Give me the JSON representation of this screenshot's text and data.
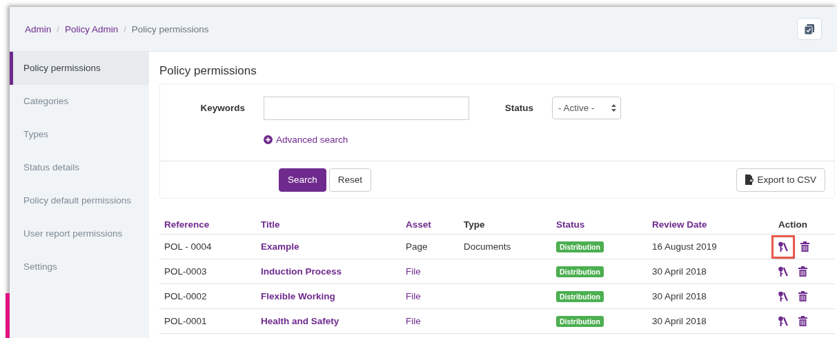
{
  "breadcrumb_separator": "/",
  "breadcrumb": [
    {
      "label": "Admin",
      "link": true
    },
    {
      "label": "Policy Admin",
      "link": true
    },
    {
      "label": "Policy permissions",
      "link": false
    }
  ],
  "sidebar": {
    "items": [
      {
        "label": "Policy permissions",
        "selected": true
      },
      {
        "label": "Categories",
        "selected": false
      },
      {
        "label": "Types",
        "selected": false
      },
      {
        "label": "Status details",
        "selected": false
      },
      {
        "label": "Policy default permissions",
        "selected": false
      },
      {
        "label": "User report permissions",
        "selected": false
      },
      {
        "label": "Settings",
        "selected": false
      }
    ]
  },
  "page_title": "Policy permissions",
  "filters": {
    "keywords_label": "Keywords",
    "status_label": "Status",
    "status_value": "- Active -",
    "advanced_search": "Advanced search"
  },
  "buttons": {
    "search": "Search",
    "reset": "Reset",
    "export": "Export to CSV"
  },
  "table": {
    "columns": [
      {
        "label": "Reference",
        "sortable": true
      },
      {
        "label": "Title",
        "sortable": true
      },
      {
        "label": "Asset",
        "sortable": true
      },
      {
        "label": "Type",
        "sortable": false
      },
      {
        "label": "Status",
        "sortable": true
      },
      {
        "label": "Review Date",
        "sortable": true
      },
      {
        "label": "Action",
        "sortable": false
      }
    ],
    "rows": [
      {
        "reference": "POL - 0004",
        "title": "Example",
        "asset": "Page",
        "asset_link": false,
        "type": "Documents",
        "status": "Distribution",
        "review_date": "16 August 2019",
        "highlighted": true
      },
      {
        "reference": "POL-0003",
        "title": "Induction Process",
        "asset": "File",
        "asset_link": true,
        "status": "Distribution",
        "review_date": "30 April 2018",
        "highlighted": false
      },
      {
        "reference": "POL-0002",
        "title": "Flexible Working",
        "asset": "File",
        "asset_link": true,
        "status": "Distribution",
        "review_date": "30 April 2018",
        "highlighted": false
      },
      {
        "reference": "POL-0001",
        "title": "Health and Safety",
        "asset": "File",
        "asset_link": true,
        "status": "Distribution",
        "review_date": "30 April 2018",
        "highlighted": false
      }
    ]
  }
}
